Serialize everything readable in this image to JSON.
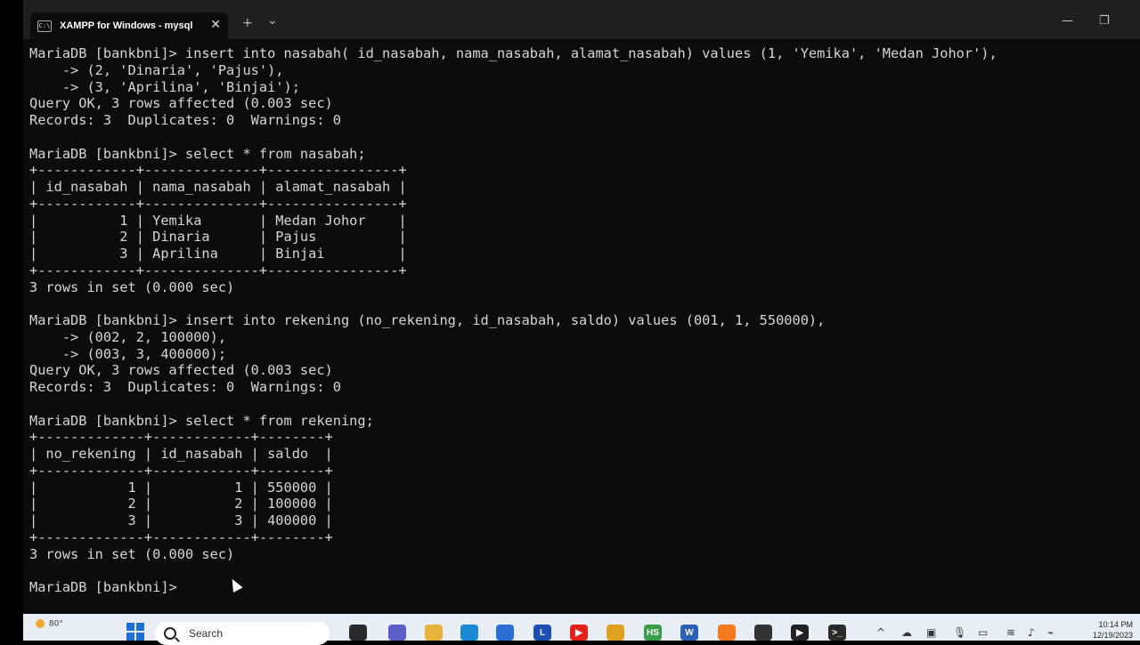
{
  "window": {
    "tab_title": "XAMPP for Windows - mysql",
    "tab_icon": "terminal-icon",
    "close_label": "✕",
    "new_tab_label": "+",
    "dropdown_label": "⌄",
    "minimize_label": "—",
    "maximize_label": "❐"
  },
  "terminal": {
    "lines": [
      "MariaDB [bankbni]> insert into nasabah( id_nasabah, nama_nasabah, alamat_nasabah) values (1, 'Yemika', 'Medan Johor'),",
      "    -> (2, 'Dinaria', 'Pajus'),",
      "    -> (3, 'Aprilina', 'Binjai');",
      "Query OK, 3 rows affected (0.003 sec)",
      "Records: 3  Duplicates: 0  Warnings: 0",
      "",
      "MariaDB [bankbni]> select * from nasabah;",
      "+------------+--------------+----------------+",
      "| id_nasabah | nama_nasabah | alamat_nasabah |",
      "+------------+--------------+----------------+",
      "|          1 | Yemika       | Medan Johor    |",
      "|          2 | Dinaria      | Pajus          |",
      "|          3 | Aprilina     | Binjai         |",
      "+------------+--------------+----------------+",
      "3 rows in set (0.000 sec)",
      "",
      "MariaDB [bankbni]> insert into rekening (no_rekening, id_nasabah, saldo) values (001, 1, 550000),",
      "    -> (002, 2, 100000),",
      "    -> (003, 3, 400000);",
      "Query OK, 3 rows affected (0.003 sec)",
      "Records: 3  Duplicates: 0  Warnings: 0",
      "",
      "MariaDB [bankbni]> select * from rekening;",
      "+-------------+------------+--------+",
      "| no_rekening | id_nasabah | saldo  |",
      "+-------------+------------+--------+",
      "|           1 |          1 | 550000 |",
      "|           2 |          2 | 100000 |",
      "|           3 |          3 | 400000 |",
      "+-------------+------------+--------+",
      "3 rows in set (0.000 sec)",
      "",
      "MariaDB [bankbni]> "
    ]
  },
  "taskbar": {
    "weather_temp": "80°",
    "search_label": "Search",
    "apps": [
      {
        "name": "taskview-icon",
        "label": "",
        "color": "#2a2a2a"
      },
      {
        "name": "teams-icon",
        "label": "",
        "color": "#5b5fc7"
      },
      {
        "name": "file-explorer-icon",
        "label": "",
        "color": "#e8b339"
      },
      {
        "name": "edge-icon",
        "label": "",
        "color": "#1a8ad6"
      },
      {
        "name": "store-icon",
        "label": "",
        "color": "#2a6fd6"
      },
      {
        "name": "l-app-icon",
        "label": "L",
        "color": "#1b4fb3"
      },
      {
        "name": "youtube-icon",
        "label": "▶",
        "color": "#e62117"
      },
      {
        "name": "chrome-icon",
        "label": "",
        "color": "#e0a020"
      },
      {
        "name": "hs-app-icon",
        "label": "HS",
        "color": "#3a9d4a"
      },
      {
        "name": "word-icon",
        "label": "W",
        "color": "#2b5fb8"
      },
      {
        "name": "xampp-icon",
        "label": "",
        "color": "#f47b20"
      },
      {
        "name": "davinci-icon",
        "label": "",
        "color": "#333333"
      },
      {
        "name": "media-player-icon",
        "label": "▶",
        "color": "#222222"
      },
      {
        "name": "terminal-app-icon",
        "label": ">_",
        "color": "#2b2b2b"
      }
    ],
    "tray": [
      "chevron-up-icon",
      "onedrive-icon",
      "tray-app-icon",
      "microphone-icon",
      "battery-icon",
      "wifi-icon",
      "volume-icon",
      "battery-charging-icon"
    ],
    "time": "10:14 PM",
    "date": "12/19/2023"
  }
}
